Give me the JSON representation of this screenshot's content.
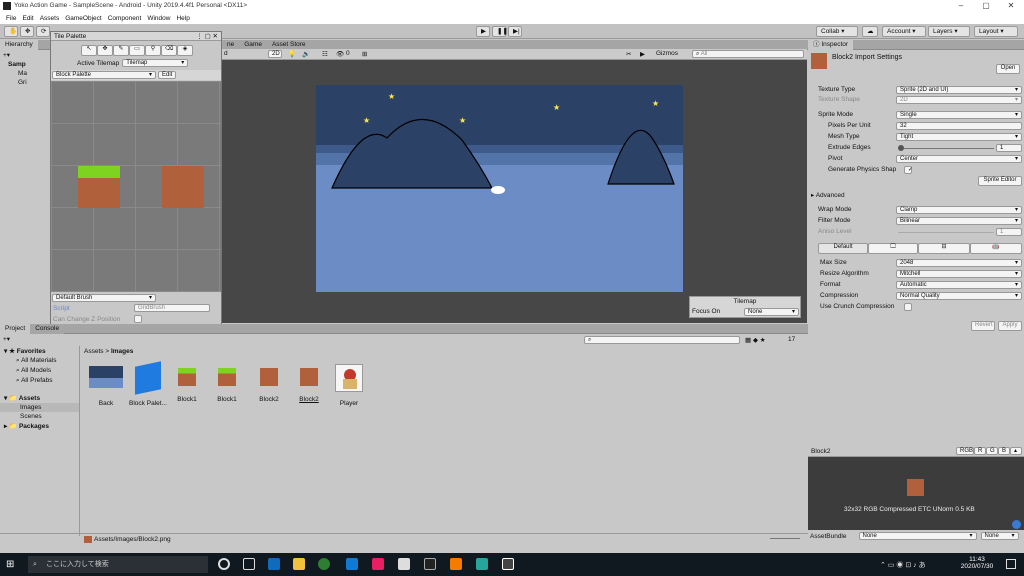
{
  "window": {
    "title": "Yoko Action Game - SampleScene - Android - Unity 2019.4.4f1 Personal <DX11>"
  },
  "menu": [
    "File",
    "Edit",
    "Assets",
    "GameObject",
    "Component",
    "Window",
    "Help"
  ],
  "toolbar": {
    "collab": "Collab",
    "account": "Account",
    "layers": "Layers",
    "layout": "Layout"
  },
  "hierarchy": {
    "tab": "Hierarchy",
    "scene": "Samp",
    "items": [
      "Ma",
      "Gri"
    ]
  },
  "tile_palette": {
    "tab": "Tile Palette",
    "active_tilemap_label": "Active Tilemap",
    "active_tilemap_value": "Tilemap",
    "palette": "Block Palette",
    "edit": "Edit",
    "brush": "Default Brush",
    "script_label": "Script",
    "script_value": "GridBrush",
    "can_change_z": "Can Change Z Position"
  },
  "scene_view": {
    "tabs": [
      "Game",
      "Asset Store"
    ],
    "mode": "2D",
    "gizmos": "Gizmos",
    "search_placeholder": "All",
    "counter": "0",
    "scene_mode_partial": "d"
  },
  "tilemap_overlay": {
    "title": "Tilemap",
    "focus_label": "Focus On",
    "focus_value": "None"
  },
  "project": {
    "tabs": [
      "Project",
      "Console"
    ],
    "favorites": {
      "label": "Favorites",
      "items": [
        "All Materials",
        "All Models",
        "All Prefabs"
      ]
    },
    "assets": {
      "label": "Assets",
      "items": [
        "Images",
        "Scenes"
      ]
    },
    "packages": "Packages",
    "breadcrumb": [
      "Assets",
      "Images"
    ],
    "count": "17",
    "files": [
      "Back",
      "Block Palet...",
      "Block1",
      "Block1",
      "Block2",
      "Block2",
      "Player"
    ],
    "status_path": "Assets/Images/Block2.png"
  },
  "inspector": {
    "tab": "Inspector",
    "title": "Block2 Import Settings",
    "open": "Open",
    "texture_type": {
      "label": "Texture Type",
      "value": "Sprite (2D and UI)"
    },
    "texture_shape": {
      "label": "Texture Shape",
      "value": "2D"
    },
    "sprite_mode": {
      "label": "Sprite Mode",
      "value": "Single"
    },
    "ppu": {
      "label": "Pixels Per Unit",
      "value": "32"
    },
    "mesh_type": {
      "label": "Mesh Type",
      "value": "Tight"
    },
    "extrude": {
      "label": "Extrude Edges",
      "value": "1"
    },
    "pivot": {
      "label": "Pivot",
      "value": "Center"
    },
    "physics": {
      "label": "Generate Physics Shap"
    },
    "sprite_editor": "Sprite Editor",
    "advanced": "Advanced",
    "wrap_mode": {
      "label": "Wrap Mode",
      "value": "Clamp"
    },
    "filter_mode": {
      "label": "Filter Mode",
      "value": "Bilinear"
    },
    "aniso": {
      "label": "Aniso Level",
      "value": "1"
    },
    "platform_tab": "Default",
    "max_size": {
      "label": "Max Size",
      "value": "2048"
    },
    "resize": {
      "label": "Resize Algorithm",
      "value": "Mitchell"
    },
    "format": {
      "label": "Format",
      "value": "Automatic"
    },
    "compression": {
      "label": "Compression",
      "value": "Normal Quality"
    },
    "crunch": {
      "label": "Use Crunch Compression"
    },
    "revert": "Revert",
    "apply": "Apply"
  },
  "preview": {
    "name": "Block2",
    "channels": [
      "RGB",
      "R",
      "G",
      "B"
    ],
    "info": "32x32  RGB Compressed ETC UNorm   0.5 KB",
    "assetbundle_label": "AssetBundle",
    "assetbundle_value": "None",
    "variant_value": "None"
  },
  "taskbar": {
    "search_placeholder": "ここに入力して検索",
    "time": "11:43",
    "date": "2020/07/30"
  },
  "colors": {
    "sky": "#2c4166",
    "ground": "#6b8cc4",
    "grass": "#7ed321",
    "dirt": "#b0603a"
  }
}
